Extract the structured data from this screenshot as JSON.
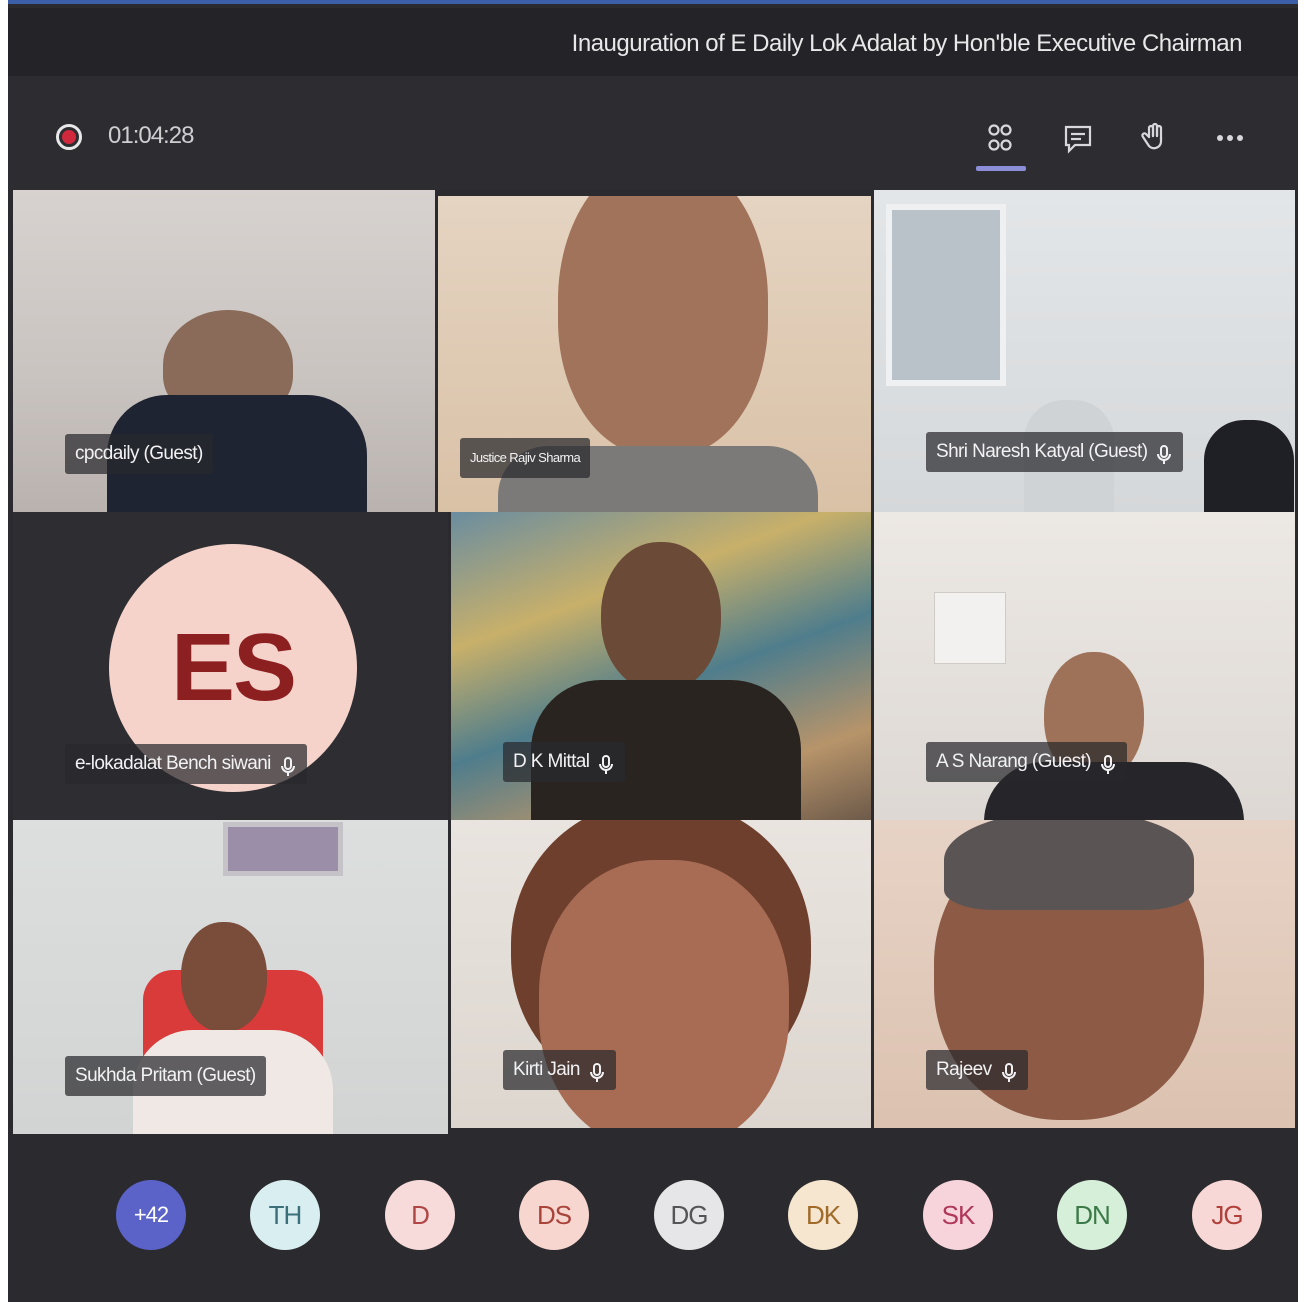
{
  "header": {
    "meeting_title": "Inauguration of E Daily Lok Adalat by Hon'ble Executive Chairman"
  },
  "toolbar": {
    "recording_time": "01:04:28",
    "icons": [
      "people-icon",
      "chat-icon",
      "raise-hand-icon",
      "more-options-icon"
    ]
  },
  "participants": [
    {
      "name": "cpcdaily (Guest)",
      "mic": false
    },
    {
      "name": "Justice Rajiv Sharma",
      "mic": false
    },
    {
      "name": "Shri Naresh Katyal (Guest)",
      "mic": true
    },
    {
      "name": "e-lokadalat Bench siwani",
      "mic": true,
      "initials": "ES"
    },
    {
      "name": "D K Mittal",
      "mic": true
    },
    {
      "name": "A S Narang (Guest)",
      "mic": true
    },
    {
      "name": "Sukhda Pritam (Guest)",
      "mic": false
    },
    {
      "name": "Kirti Jain",
      "mic": true
    },
    {
      "name": "Rajeev",
      "mic": true
    }
  ],
  "overflow": {
    "more_count": "+42",
    "avatars": [
      {
        "initials": "TH",
        "bg": "#d8eef0",
        "fg": "#3b6f7a"
      },
      {
        "initials": "D",
        "bg": "#f7dada",
        "fg": "#b04545"
      },
      {
        "initials": "DS",
        "bg": "#f7d6d0",
        "fg": "#a8443a"
      },
      {
        "initials": "DG",
        "bg": "#e6e6e8",
        "fg": "#555558"
      },
      {
        "initials": "DK",
        "bg": "#f6e6cf",
        "fg": "#a06a2a"
      },
      {
        "initials": "SK",
        "bg": "#f7d4db",
        "fg": "#b0365a"
      },
      {
        "initials": "DN",
        "bg": "#d6efd9",
        "fg": "#3c7a48"
      },
      {
        "initials": "JG",
        "bg": "#f8d8d6",
        "fg": "#b0403a"
      }
    ],
    "more_bg": "#5b63c8"
  }
}
